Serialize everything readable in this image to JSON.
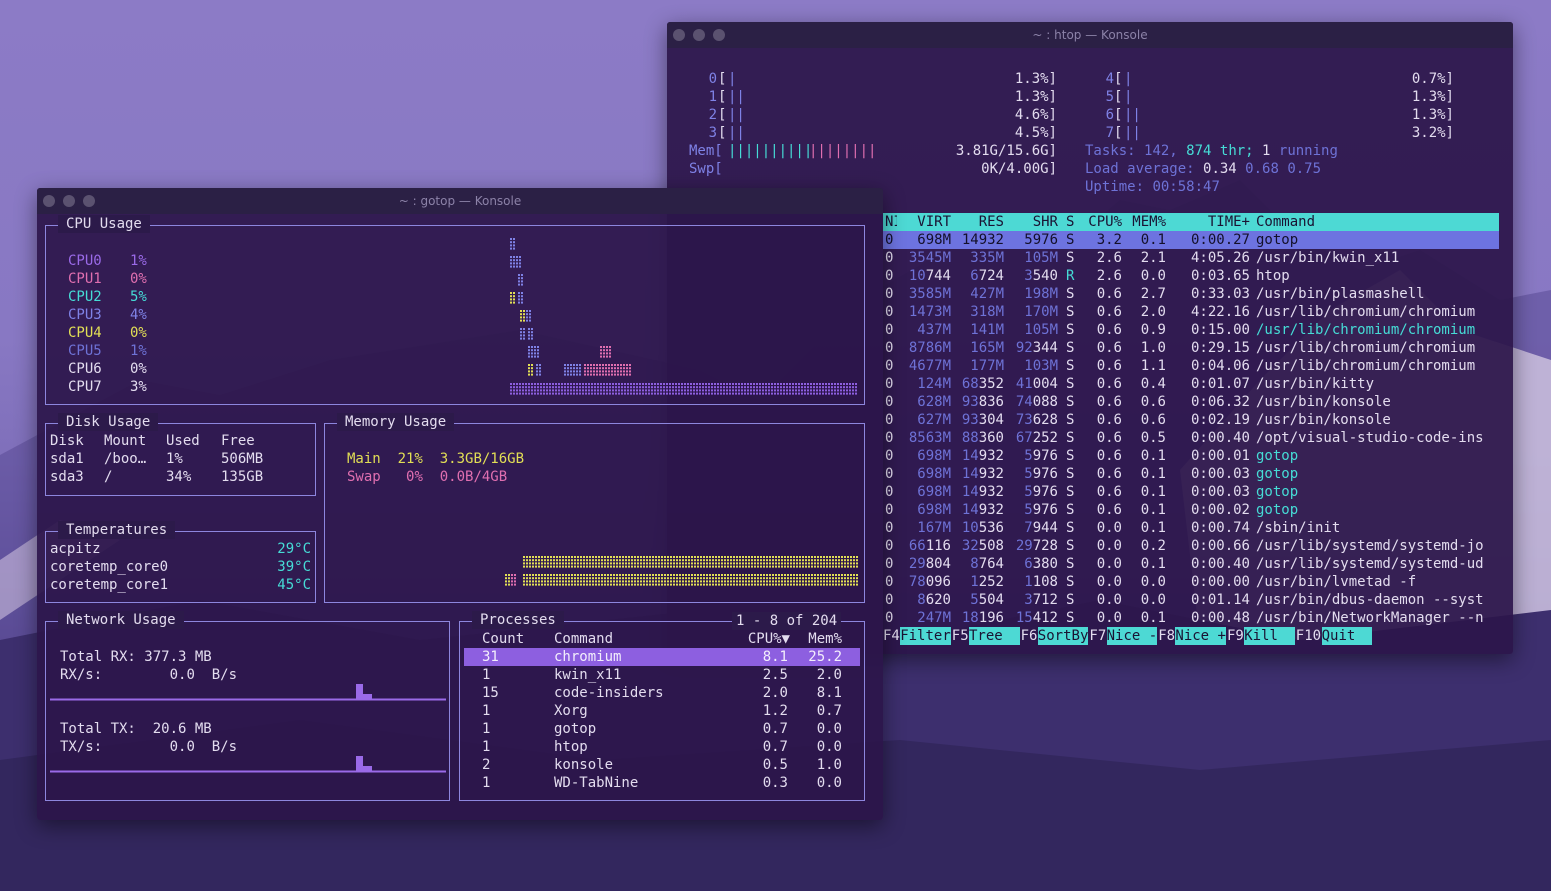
{
  "htop": {
    "title": "~ : htop — Konsole",
    "cpus_left": [
      {
        "id": "0",
        "bar": "|",
        "pct": "1.3%]"
      },
      {
        "id": "1",
        "bar": "||",
        "pct": "1.3%]"
      },
      {
        "id": "2",
        "bar": "||",
        "pct": "4.6%]"
      },
      {
        "id": "3",
        "bar": "||",
        "pct": "4.5%]"
      }
    ],
    "cpus_right": [
      {
        "id": "4",
        "bar": "|",
        "pct": "0.7%]"
      },
      {
        "id": "5",
        "bar": "|",
        "pct": "1.3%]"
      },
      {
        "id": "6",
        "bar": "||",
        "pct": "1.3%]"
      },
      {
        "id": "7",
        "bar": "||",
        "pct": "3.2%]"
      }
    ],
    "mem": {
      "label": "Mem[",
      "bar_a": "||||||||||",
      "bar_b": "||||||||",
      "value": "3.81G/15.6G]"
    },
    "swp": {
      "label": "Swp[",
      "value": "0K/4.00G]"
    },
    "tasks": {
      "label": "Tasks:",
      "count": "142,",
      "threads": "874 thr;",
      "running_n": "1",
      "running": "running"
    },
    "load": {
      "label": "Load average:",
      "v1": "0.34",
      "v2": "0.68",
      "v3": "0.75"
    },
    "uptime": {
      "label": "Uptime:",
      "value": "00:58:47"
    },
    "columns": [
      "NI",
      "VIRT",
      "RES",
      "SHR",
      "S",
      "CPU%",
      "MEM%",
      "TIME+",
      "Command"
    ],
    "processes": [
      {
        "ni": "0",
        "virt": "698M",
        "res": "14932",
        "shr": "5976",
        "s": "S",
        "cpu": "3.2",
        "mem": "0.1",
        "time": "0:00.27",
        "cmd": "gotop"
      },
      {
        "ni": "0",
        "virt": "3545M",
        "res": "335M",
        "shr": "105M",
        "s": "S",
        "cpu": "2.6",
        "mem": "2.1",
        "time": "4:05.26",
        "cmd": "/usr/bin/kwin_x11"
      },
      {
        "ni": "0",
        "virt": "10744",
        "res": "6724",
        "shr": "3540",
        "s": "R",
        "cpu": "2.6",
        "mem": "0.0",
        "time": "0:03.65",
        "cmd": "htop"
      },
      {
        "ni": "0",
        "virt": "3585M",
        "res": "427M",
        "shr": "198M",
        "s": "S",
        "cpu": "0.6",
        "mem": "2.7",
        "time": "0:33.03",
        "cmd": "/usr/bin/plasmashell"
      },
      {
        "ni": "0",
        "virt": "1473M",
        "res": "318M",
        "shr": "170M",
        "s": "S",
        "cpu": "0.6",
        "mem": "2.0",
        "time": "4:22.16",
        "cmd": "/usr/lib/chromium/chromium"
      },
      {
        "ni": "0",
        "virt": "437M",
        "res": "141M",
        "shr": "105M",
        "s": "S",
        "cpu": "0.6",
        "mem": "0.9",
        "time": "0:15.00",
        "cmd": "/usr/lib/chromium/chromium"
      },
      {
        "ni": "0",
        "virt": "8786M",
        "res": "165M",
        "shr": "92344",
        "s": "S",
        "cpu": "0.6",
        "mem": "1.0",
        "time": "0:29.15",
        "cmd": "/usr/lib/chromium/chromium"
      },
      {
        "ni": "0",
        "virt": "4677M",
        "res": "177M",
        "shr": "103M",
        "s": "S",
        "cpu": "0.6",
        "mem": "1.1",
        "time": "0:04.06",
        "cmd": "/usr/lib/chromium/chromium"
      },
      {
        "ni": "0",
        "virt": "124M",
        "res": "68352",
        "shr": "41004",
        "s": "S",
        "cpu": "0.6",
        "mem": "0.4",
        "time": "0:01.07",
        "cmd": "/usr/bin/kitty"
      },
      {
        "ni": "0",
        "virt": "628M",
        "res": "93836",
        "shr": "74088",
        "s": "S",
        "cpu": "0.6",
        "mem": "0.6",
        "time": "0:06.32",
        "cmd": "/usr/bin/konsole"
      },
      {
        "ni": "0",
        "virt": "627M",
        "res": "93304",
        "shr": "73628",
        "s": "S",
        "cpu": "0.6",
        "mem": "0.6",
        "time": "0:02.19",
        "cmd": "/usr/bin/konsole"
      },
      {
        "ni": "0",
        "virt": "8563M",
        "res": "88360",
        "shr": "67252",
        "s": "S",
        "cpu": "0.6",
        "mem": "0.5",
        "time": "0:00.40",
        "cmd": "/opt/visual-studio-code-ins"
      },
      {
        "ni": "0",
        "virt": "698M",
        "res": "14932",
        "shr": "5976",
        "s": "S",
        "cpu": "0.6",
        "mem": "0.1",
        "time": "0:00.01",
        "cmd": "gotop"
      },
      {
        "ni": "0",
        "virt": "698M",
        "res": "14932",
        "shr": "5976",
        "s": "S",
        "cpu": "0.6",
        "mem": "0.1",
        "time": "0:00.03",
        "cmd": "gotop"
      },
      {
        "ni": "0",
        "virt": "698M",
        "res": "14932",
        "shr": "5976",
        "s": "S",
        "cpu": "0.6",
        "mem": "0.1",
        "time": "0:00.03",
        "cmd": "gotop"
      },
      {
        "ni": "0",
        "virt": "698M",
        "res": "14932",
        "shr": "5976",
        "s": "S",
        "cpu": "0.6",
        "mem": "0.1",
        "time": "0:00.02",
        "cmd": "gotop"
      },
      {
        "ni": "0",
        "virt": "167M",
        "res": "10536",
        "shr": "7944",
        "s": "S",
        "cpu": "0.0",
        "mem": "0.1",
        "time": "0:00.74",
        "cmd": "/sbin/init"
      },
      {
        "ni": "0",
        "virt": "66116",
        "res": "32508",
        "shr": "29728",
        "s": "S",
        "cpu": "0.0",
        "mem": "0.2",
        "time": "0:00.66",
        "cmd": "/usr/lib/systemd/systemd-jo"
      },
      {
        "ni": "0",
        "virt": "29804",
        "res": "8764",
        "shr": "6380",
        "s": "S",
        "cpu": "0.0",
        "mem": "0.1",
        "time": "0:00.40",
        "cmd": "/usr/lib/systemd/systemd-ud"
      },
      {
        "ni": "0",
        "virt": "78096",
        "res": "1252",
        "shr": "1108",
        "s": "S",
        "cpu": "0.0",
        "mem": "0.0",
        "time": "0:00.00",
        "cmd": "/usr/bin/lvmetad -f"
      },
      {
        "ni": "0",
        "virt": "8620",
        "res": "5504",
        "shr": "3712",
        "s": "S",
        "cpu": "0.0",
        "mem": "0.0",
        "time": "0:01.14",
        "cmd": "/usr/bin/dbus-daemon --syst"
      },
      {
        "ni": "0",
        "virt": "247M",
        "res": "18196",
        "shr": "15412",
        "s": "S",
        "cpu": "0.0",
        "mem": "0.1",
        "time": "0:00.48",
        "cmd": "/usr/bin/NetworkManager --n"
      }
    ],
    "fkeys": [
      {
        "k": "F4",
        "l": "Filter"
      },
      {
        "k": "F5",
        "l": "Tree  "
      },
      {
        "k": "F6",
        "l": "SortBy"
      },
      {
        "k": "F7",
        "l": "Nice -"
      },
      {
        "k": "F8",
        "l": "Nice +"
      },
      {
        "k": "F9",
        "l": "Kill  "
      },
      {
        "k": "F10",
        "l": "Quit  "
      }
    ]
  },
  "gotop": {
    "title": "~ : gotop — Konsole",
    "cpu_title": "CPU Usage",
    "cpus": [
      {
        "name": "CPU0",
        "pct": "1%"
      },
      {
        "name": "CPU1",
        "pct": "0%"
      },
      {
        "name": "CPU2",
        "pct": "5%"
      },
      {
        "name": "CPU3",
        "pct": "4%"
      },
      {
        "name": "CPU4",
        "pct": "0%"
      },
      {
        "name": "CPU5",
        "pct": "1%"
      },
      {
        "name": "CPU6",
        "pct": "0%"
      },
      {
        "name": "CPU7",
        "pct": "3%"
      }
    ],
    "disk": {
      "title": "Disk Usage",
      "headers": [
        "Disk",
        "Mount",
        "Used",
        "Free"
      ],
      "rows": [
        {
          "disk": "sda1",
          "mount": "/boo…",
          "used": "1%",
          "free": "506MB"
        },
        {
          "disk": "sda3",
          "mount": "/",
          "used": "34%",
          "free": "135GB"
        }
      ]
    },
    "temps": {
      "title": "Temperatures",
      "rows": [
        {
          "name": "acpitz",
          "val": "29°C"
        },
        {
          "name": "coretemp_core0",
          "val": "39°C"
        },
        {
          "name": "coretemp_core1",
          "val": "45°C"
        }
      ]
    },
    "memory": {
      "title": "Memory Usage",
      "main": {
        "label": "Main",
        "pct": "21%",
        "val": "3.3GB/16GB"
      },
      "swap": {
        "label": "Swap",
        "pct": "0%",
        "val": "0.0B/4GB"
      }
    },
    "network": {
      "title": "Network Usage",
      "rx_total_label": "Total RX:",
      "rx_total": "377.3 MB",
      "rx_rate_label": "RX/s:",
      "rx_rate": "0.0  B/s",
      "tx_total_label": "Total TX:",
      "tx_total": "20.6 MB",
      "tx_rate_label": "TX/s:",
      "tx_rate": "0.0  B/s"
    },
    "procs": {
      "title": "Processes",
      "range": "1 - 8 of 204",
      "headers": {
        "count": "Count",
        "command": "Command",
        "cpu": "CPU%▼",
        "mem": "Mem%"
      },
      "rows": [
        {
          "count": "31",
          "cmd": "chromium",
          "cpu": "8.1",
          "mem": "25.2"
        },
        {
          "count": "1",
          "cmd": "kwin_x11",
          "cpu": "2.5",
          "mem": "2.0"
        },
        {
          "count": "15",
          "cmd": "code-insiders",
          "cpu": "2.0",
          "mem": "8.1"
        },
        {
          "count": "1",
          "cmd": "Xorg",
          "cpu": "1.2",
          "mem": "0.7"
        },
        {
          "count": "1",
          "cmd": "gotop",
          "cpu": "0.7",
          "mem": "0.0"
        },
        {
          "count": "1",
          "cmd": "htop",
          "cpu": "0.7",
          "mem": "0.0"
        },
        {
          "count": "2",
          "cmd": "konsole",
          "cpu": "0.5",
          "mem": "1.0"
        },
        {
          "count": "1",
          "cmd": "WD-TabNine",
          "cpu": "0.3",
          "mem": "0.0"
        }
      ]
    }
  },
  "colors": {
    "accent": "#8d86de",
    "cyan": "#4dd9d4",
    "selection": "#6d73e0",
    "gotop_selection": "#8d5fe0"
  }
}
